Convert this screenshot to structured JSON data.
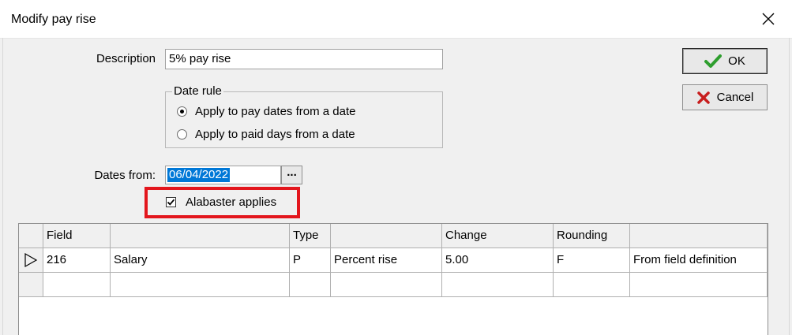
{
  "window": {
    "title": "Modify pay rise"
  },
  "description": {
    "label": "Description",
    "value": "5% pay rise"
  },
  "date_rule": {
    "legend": "Date rule",
    "options": [
      {
        "label": "Apply to pay dates from a date",
        "selected": true
      },
      {
        "label": "Apply to paid days from a date",
        "selected": false
      }
    ]
  },
  "dates_from": {
    "label": "Dates from:",
    "value": "06/04/2022",
    "browse_label": "..."
  },
  "alabaster": {
    "label": "Alabaster applies",
    "checked": true
  },
  "buttons": {
    "ok": "OK",
    "cancel": "Cancel"
  },
  "grid": {
    "headers": [
      "Field",
      "",
      "Type",
      "",
      "Change",
      "Rounding",
      ""
    ],
    "rows": [
      [
        "216",
        "Salary",
        "P",
        "Percent rise",
        "5.00",
        "F",
        "From field definition"
      ],
      [
        "",
        "",
        "",
        "",
        "",
        "",
        ""
      ]
    ]
  },
  "colors": {
    "highlight": "#e3161d",
    "selection": "#0078d7",
    "ok_check": "#2e9e2e",
    "cancel_x": "#c81e1e"
  },
  "icons": [
    "close-icon",
    "check-icon",
    "x-icon",
    "row-pointer-icon",
    "checkmark-icon"
  ]
}
